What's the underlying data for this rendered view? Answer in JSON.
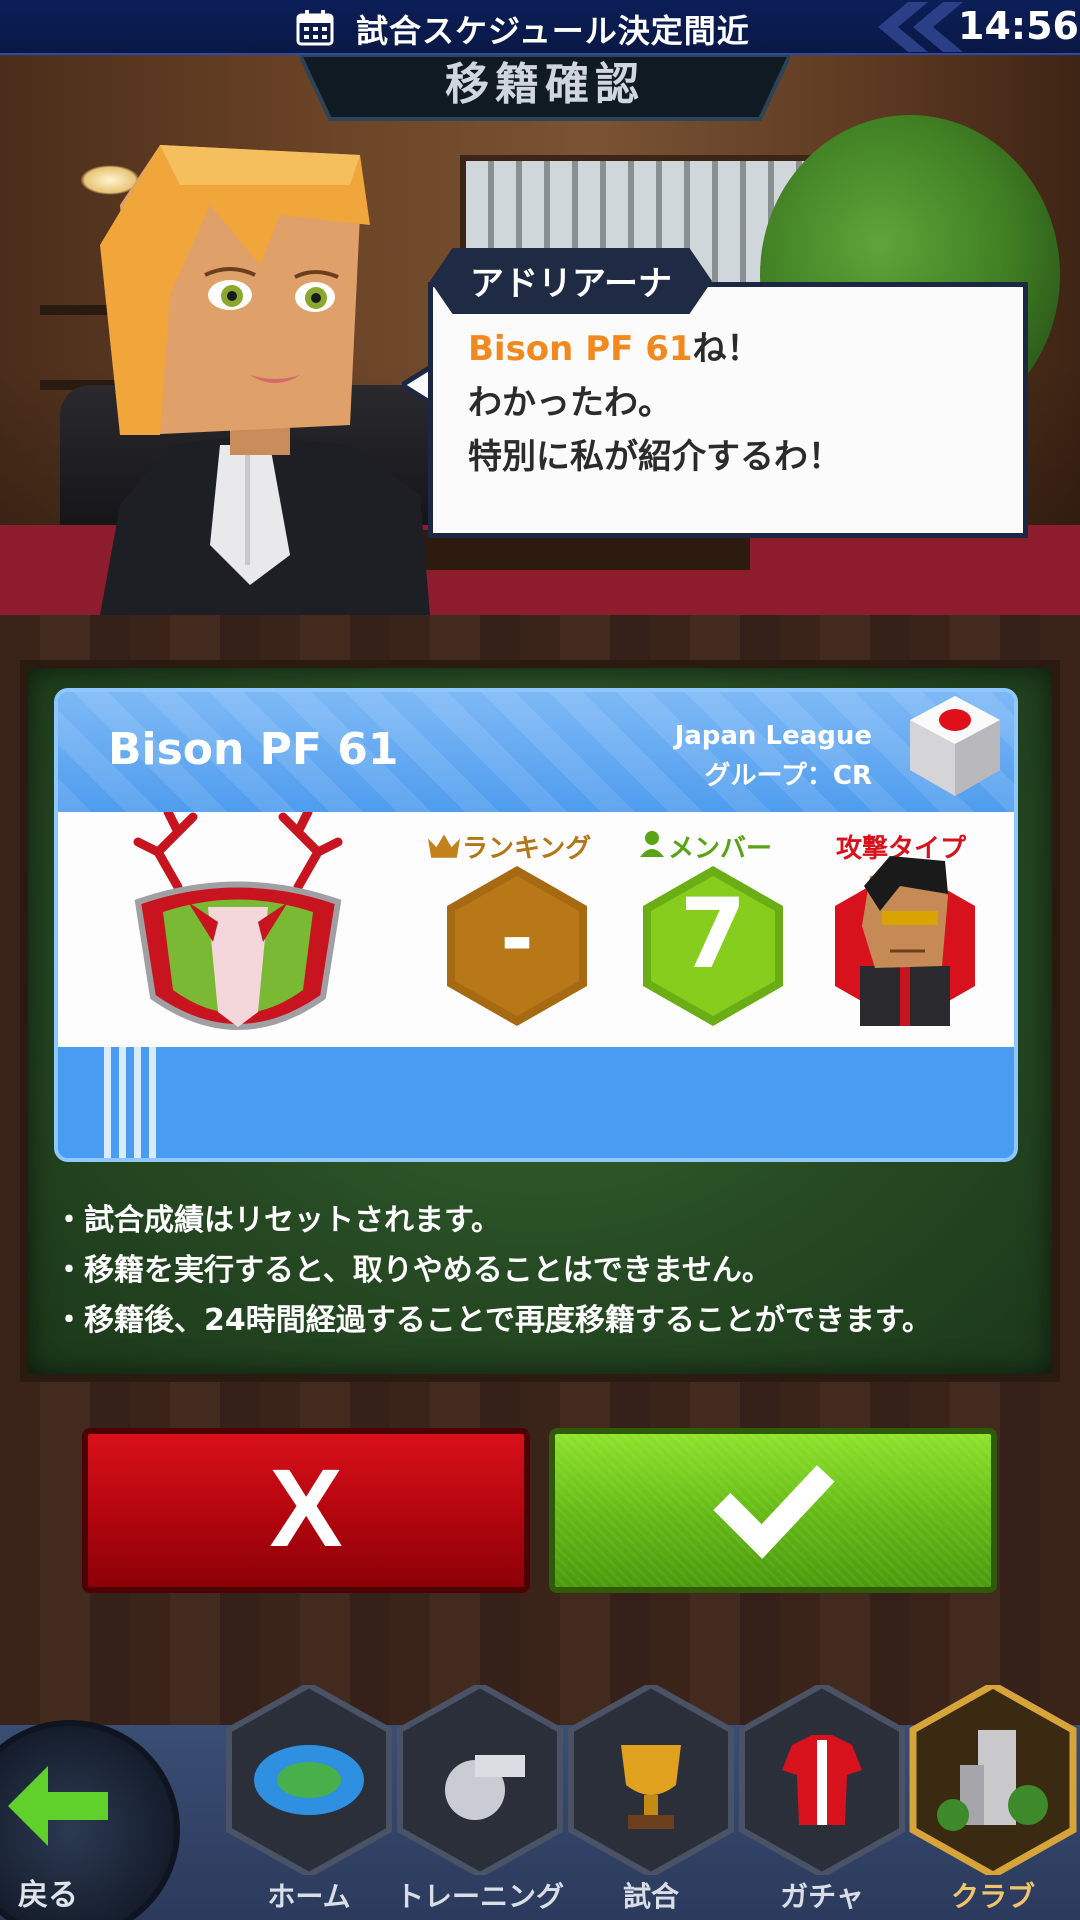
{
  "status_bar": {
    "notice": "試合スケジュール決定間近",
    "time": "14:56"
  },
  "header": {
    "title": "移籍確認"
  },
  "dialog": {
    "speaker": "アドリアーナ",
    "line1_highlight": "Bison PF 61",
    "line1_rest": "ね！",
    "line2": "わかったわ。",
    "line3": "特別に私が紹介するわ！"
  },
  "club_card": {
    "club_name": "Bison PF 61",
    "league": "Japan League",
    "group": "グループ：CR",
    "ranking_label": "ランキング",
    "ranking_value": "-",
    "members_label": "メンバー",
    "members_value": "7",
    "type_label": "攻撃タイプ",
    "colors": {
      "header": "#4f9cee",
      "ranking_hex": "#a66a12",
      "members_hex": "#7cc41a",
      "type_hex": "#d8121c"
    }
  },
  "rules": [
    "・試合成績はリセットされます。",
    "・移籍を実行すると、取りやめることはできません。",
    "・移籍後、24時間経過することで再度移籍することができます。"
  ],
  "buttons": {
    "cancel_icon": "x-icon",
    "cancel_glyph": "X",
    "confirm_icon": "check-icon"
  },
  "nav": {
    "back_label": "戻る",
    "items": [
      {
        "label": "ホーム",
        "icon": "stadium-icon"
      },
      {
        "label": "トレーニング",
        "icon": "whistle-icon"
      },
      {
        "label": "試合",
        "icon": "trophy-icon"
      },
      {
        "label": "ガチャ",
        "icon": "jersey-icon"
      },
      {
        "label": "クラブ",
        "icon": "clubhouse-icon"
      }
    ],
    "active_index": 4
  }
}
